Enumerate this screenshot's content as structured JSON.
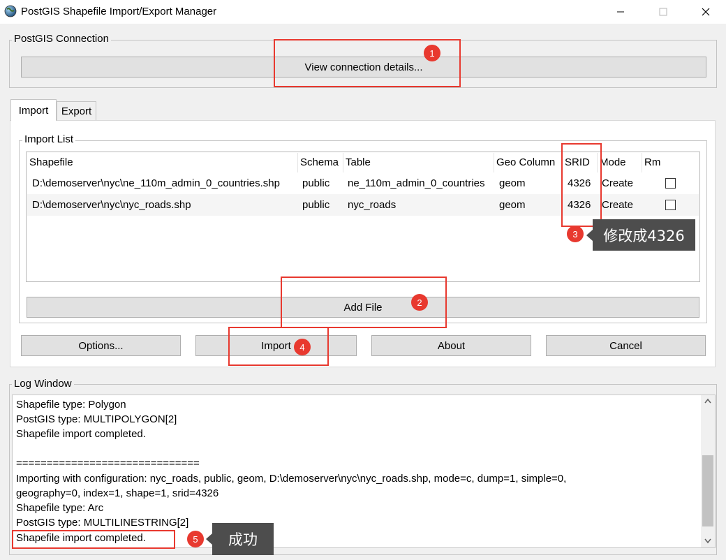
{
  "window": {
    "title": "PostGIS Shapefile Import/Export Manager"
  },
  "connection": {
    "legend": "PostGIS Connection",
    "view_details_label": "View connection details..."
  },
  "tabs": [
    {
      "label": "Import"
    },
    {
      "label": "Export"
    }
  ],
  "import_list": {
    "legend": "Import List",
    "columns": [
      "Shapefile",
      "Schema",
      "Table",
      "Geo Column",
      "SRID",
      "Mode",
      "Rm"
    ],
    "rows": [
      {
        "shapefile": "D:\\demoserver\\nyc\\ne_110m_admin_0_countries.shp",
        "schema": "public",
        "table": "ne_110m_admin_0_countries",
        "geo_column": "geom",
        "srid": "4326",
        "mode": "Create",
        "rm": false
      },
      {
        "shapefile": "D:\\demoserver\\nyc\\nyc_roads.shp",
        "schema": "public",
        "table": "nyc_roads",
        "geo_column": "geom",
        "srid": "4326",
        "mode": "Create",
        "rm": false
      }
    ],
    "add_file_label": "Add File"
  },
  "actions": {
    "options_label": "Options...",
    "import_label": "Import",
    "about_label": "About",
    "cancel_label": "Cancel"
  },
  "log": {
    "legend": "Log Window",
    "lines": [
      "Shapefile type: Polygon",
      "PostGIS type: MULTIPOLYGON[2]",
      "Shapefile import completed.",
      "",
      "==============================",
      "Importing with configuration: nyc_roads, public, geom, D:\\demoserver\\nyc\\nyc_roads.shp, mode=c, dump=1, simple=0,",
      "geography=0, index=1, shape=1, srid=4326",
      "Shapefile type: Arc",
      "PostGIS type: MULTILINESTRING[2]",
      "Shapefile import completed."
    ]
  },
  "annotations": {
    "badges": [
      "1",
      "2",
      "3",
      "4",
      "5"
    ],
    "callout_srid": "修改成4326",
    "callout_success": "成功",
    "color": "#e8392f"
  }
}
